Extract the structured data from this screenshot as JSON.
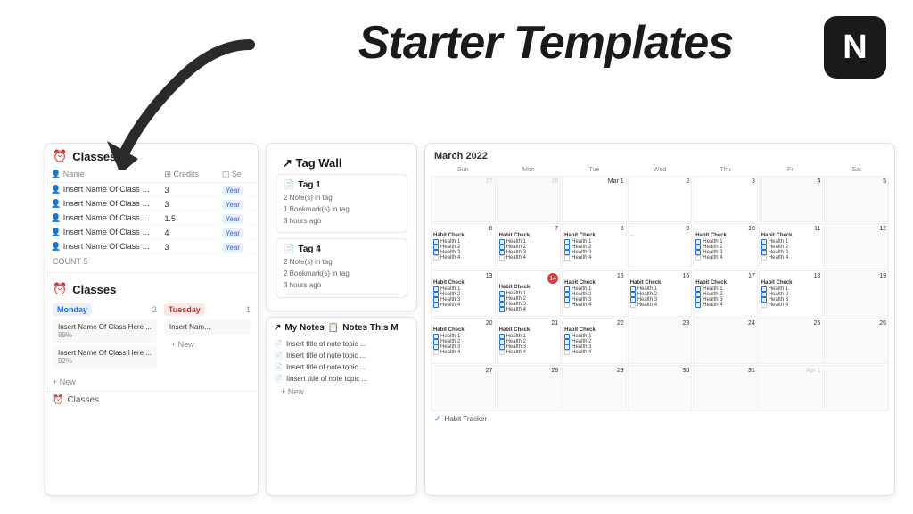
{
  "title": "Starter Templates",
  "notion_logo": "N",
  "arrow": "↙",
  "left_panel": {
    "classes_db": {
      "header": "Classes",
      "columns": [
        "Name",
        "Credits",
        "Se"
      ],
      "rows": [
        {
          "name": "Insert Name Of Class Here ....",
          "credits": "3",
          "badge": "Year"
        },
        {
          "name": "Insert Name Of Class Here ....",
          "credits": "3",
          "badge": "Year"
        },
        {
          "name": "Insert Name Of Class Here ....",
          "credits": "1.5",
          "badge": "Year"
        },
        {
          "name": "Insert Name Of Class Here ....",
          "credits": "4",
          "badge": "Year"
        },
        {
          "name": "Insert Name Of Class Here ....",
          "credits": "3",
          "badge": "Year"
        }
      ],
      "count": "COUNT 5"
    },
    "classes_board": {
      "header": "Classes",
      "col_monday": "Monday",
      "col_monday_count": "2",
      "col_tuesday": "Tuesday",
      "col_tuesday_count": "1",
      "cards_monday": [
        {
          "name": "Insert Name Of Class Here ...",
          "pct": "89%"
        },
        {
          "name": "Insert Name Of Class Here ...",
          "pct": "92%"
        }
      ],
      "cards_tuesday": [
        {
          "name": "Insert Nam..."
        }
      ],
      "add_new": "+ New"
    },
    "classes_footer": "Classes"
  },
  "middle_panel": {
    "tag_wall": {
      "header": "↗ Tag Wall",
      "tags": [
        {
          "title": "Tag 1",
          "notes": "2 Note(s) in tag",
          "bookmarks": "1 Bookmark(s) in tag",
          "time": "3 hours ago"
        },
        {
          "title": "Tag 4",
          "notes": "2 Note(s) in tag",
          "bookmarks": "2 Bookmark(s) in tag",
          "time": "3 hours ago"
        }
      ]
    },
    "my_notes": {
      "header": "↗ My Notes",
      "notes_this_m": "Notes This M",
      "items": [
        "Insert title of note topic ...",
        "Insert title of note topic ...",
        "Insert title of note topic ...",
        "Iinsert title of note topic ..."
      ],
      "add_new": "+ New"
    }
  },
  "calendar": {
    "month": "March 2022",
    "day_headers": [
      "Sun",
      "Mon",
      "Tue",
      "Wed",
      "Thu",
      "Fri",
      "Sat"
    ],
    "footer": "✓ Habit Tracker",
    "weeks": [
      {
        "cells": [
          {
            "date": "27",
            "empty": true
          },
          {
            "date": "28",
            "empty": true
          },
          {
            "date": "1",
            "empty": false
          },
          {
            "date": "2",
            "empty": false
          },
          {
            "date": "3",
            "empty": false
          },
          {
            "date": "",
            "empty": true
          },
          {
            "date": "",
            "empty": true
          }
        ]
      },
      {
        "cells": [
          {
            "date": "6",
            "habits": true
          },
          {
            "date": "7",
            "habits": false
          },
          {
            "date": "8",
            "habits": false
          },
          {
            "date": "9",
            "habits": false
          },
          {
            "date": "10",
            "habits": true
          },
          {
            "date": "11",
            "habits": true
          },
          {
            "date": "",
            "habits": false
          }
        ]
      },
      {
        "cells": [
          {
            "date": "13",
            "habits": true
          },
          {
            "date": "14",
            "today": true
          },
          {
            "date": "15",
            "habits": true
          },
          {
            "date": "16",
            "habits": true
          },
          {
            "date": "17",
            "habits": true
          },
          {
            "date": "18",
            "habits": true
          },
          {
            "date": "",
            "habits": false
          }
        ]
      },
      {
        "cells": [
          {
            "date": "20",
            "habits": true
          },
          {
            "date": "21",
            "habits": true
          },
          {
            "date": "22",
            "habits": true
          },
          {
            "date": "23",
            "habits": false
          },
          {
            "date": "24",
            "habits": false
          },
          {
            "date": "25",
            "habits": false
          },
          {
            "date": "",
            "habits": false
          }
        ]
      },
      {
        "cells": [
          {
            "date": "27"
          },
          {
            "date": "28"
          },
          {
            "date": "29"
          },
          {
            "date": "30"
          },
          {
            "date": "31"
          },
          {
            "date": "Apr 1"
          }
        ]
      }
    ],
    "habit_items": [
      "Health 1",
      "Health 2",
      "Health 3",
      "Health 4"
    ]
  }
}
